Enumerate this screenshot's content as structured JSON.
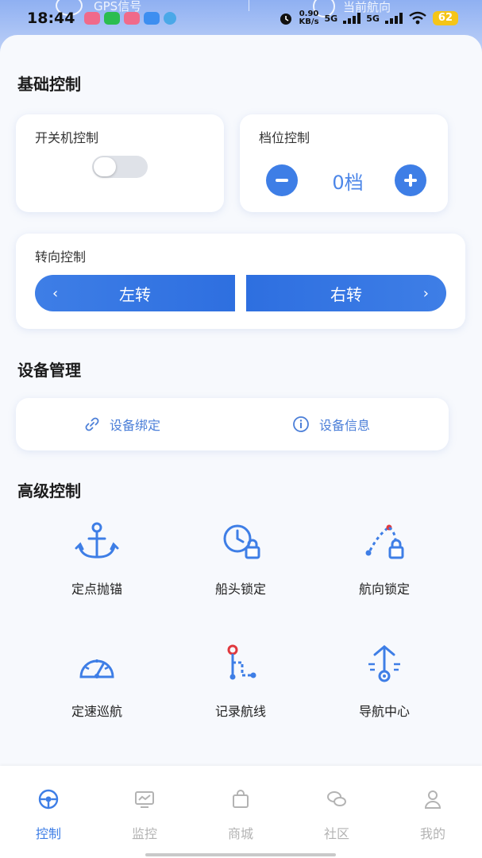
{
  "status_bar": {
    "time": "18:44",
    "net_speed_value": "0.90",
    "net_speed_unit": "KB/s",
    "signal_1": "5G",
    "signal_2": "5G",
    "battery": "62"
  },
  "header_ghost": {
    "left_label": "GPS信号",
    "right_label": "当前航向"
  },
  "basic_control": {
    "title": "基础控制",
    "power": {
      "title": "开关机控制",
      "on": false
    },
    "gear": {
      "title": "档位控制",
      "value": "0档"
    },
    "steering": {
      "title": "转向控制",
      "left_label": "左转",
      "right_label": "右转"
    }
  },
  "device_management": {
    "title": "设备管理",
    "bind_label": "设备绑定",
    "info_label": "设备信息"
  },
  "advanced_control": {
    "title": "高级控制",
    "items": [
      {
        "label": "定点抛锚",
        "icon": "anchor-icon"
      },
      {
        "label": "船头锁定",
        "icon": "clock-lock-icon"
      },
      {
        "label": "航向锁定",
        "icon": "route-lock-icon"
      },
      {
        "label": "定速巡航",
        "icon": "speedometer-icon"
      },
      {
        "label": "记录航线",
        "icon": "route-record-icon"
      },
      {
        "label": "导航中心",
        "icon": "navigation-icon"
      }
    ]
  },
  "tabbar": {
    "items": [
      {
        "label": "控制",
        "active": true
      },
      {
        "label": "监控",
        "active": false
      },
      {
        "label": "商城",
        "active": false
      },
      {
        "label": "社区",
        "active": false
      },
      {
        "label": "我的",
        "active": false
      }
    ]
  },
  "colors": {
    "accent": "#3e7ee6",
    "link": "#4c7fd8",
    "inactive": "#b3b3b3",
    "alert_red": "#e0393e"
  }
}
